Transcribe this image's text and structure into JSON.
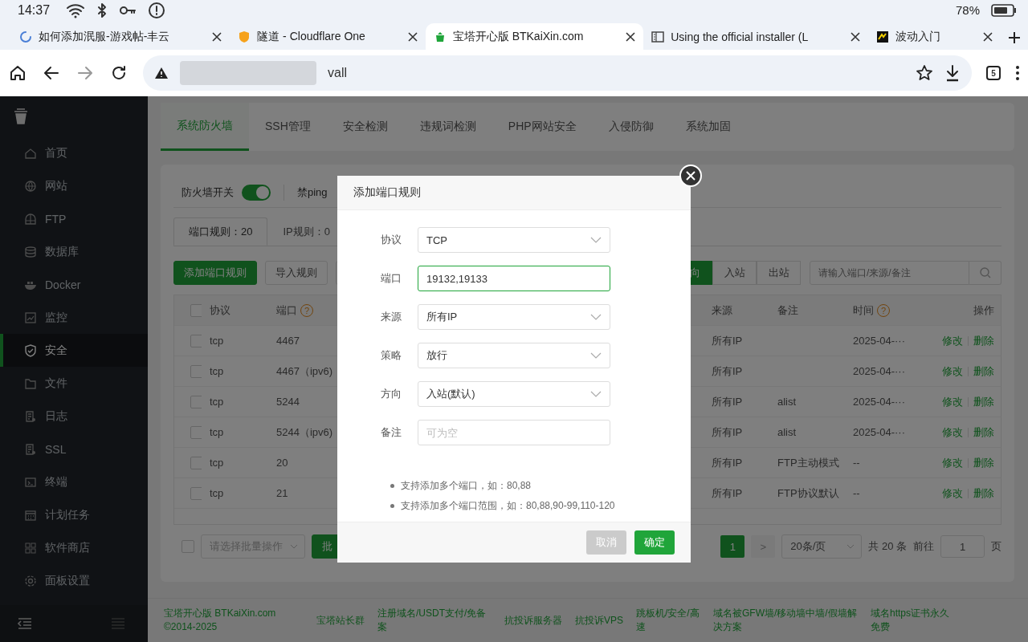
{
  "status_bar": {
    "time": "14:37",
    "battery": "78%"
  },
  "browser_tabs": [
    {
      "title": "如何添加泯服-游戏帖-丰云",
      "selected": false
    },
    {
      "title": "隧道 - Cloudflare One",
      "selected": false
    },
    {
      "title": "宝塔开心版 BTKaiXin.com",
      "selected": true
    },
    {
      "title": "Using the official installer (L",
      "selected": false
    },
    {
      "title": "波动入门",
      "selected": false
    }
  ],
  "address_bar": {
    "url": "vall",
    "tab_count": "5"
  },
  "sidebar": {
    "items": [
      {
        "label": "首页",
        "selected": false
      },
      {
        "label": "网站",
        "selected": false
      },
      {
        "label": "FTP",
        "selected": false
      },
      {
        "label": "数据库",
        "selected": false
      },
      {
        "label": "Docker",
        "selected": false
      },
      {
        "label": "监控",
        "selected": false
      },
      {
        "label": "安全",
        "selected": true
      },
      {
        "label": "文件",
        "selected": false
      },
      {
        "label": "日志",
        "selected": false
      },
      {
        "label": "SSL",
        "selected": false
      },
      {
        "label": "终端",
        "selected": false
      },
      {
        "label": "计划任务",
        "selected": false
      },
      {
        "label": "软件商店",
        "selected": false
      },
      {
        "label": "面板设置",
        "selected": false
      }
    ]
  },
  "top_tabs": [
    {
      "label": "系统防火墙",
      "selected": true
    },
    {
      "label": "SSH管理",
      "selected": false
    },
    {
      "label": "安全检测",
      "selected": false
    },
    {
      "label": "违规词检测",
      "selected": false
    },
    {
      "label": "PHP网站安全",
      "selected": false
    },
    {
      "label": "入侵防御",
      "selected": false
    },
    {
      "label": "系统加固",
      "selected": false
    }
  ],
  "firewall": {
    "switch": {
      "label": "防火墙开关",
      "on": true
    },
    "ping_label": "禁ping",
    "sub_tabs": [
      {
        "label": "端口规则：20",
        "selected": true
      },
      {
        "label": "IP规则：0",
        "selected": false
      }
    ],
    "buttons": [
      {
        "label": "添加端口规则",
        "kind": "primary"
      },
      {
        "label": "导入规则",
        "kind": "plain"
      }
    ],
    "direction_filter": [
      {
        "label": "向",
        "selected": true
      },
      {
        "label": "入站",
        "selected": false
      },
      {
        "label": "出站",
        "selected": false
      }
    ],
    "search": {
      "placeholder": "请输入端口/来源/备注"
    },
    "table": {
      "select_all_checked": false,
      "columns": [
        {
          "label": "协议"
        },
        {
          "label": "端口",
          "hint": "?"
        },
        {
          "label": "来源"
        },
        {
          "label": "备注"
        },
        {
          "label": "时间",
          "hint": "?"
        },
        {
          "label": "操作"
        }
      ],
      "rows": [
        {
          "checked": false,
          "protocol": "tcp",
          "port": "4467",
          "source": "所有IP",
          "time": "2025-04-···",
          "actions": [
            "修改",
            "删除"
          ]
        },
        {
          "checked": false,
          "protocol": "tcp",
          "port": "4467（ipv6)",
          "source": "所有IP",
          "time": "2025-04-···",
          "actions": [
            "修改",
            "删除"
          ]
        },
        {
          "checked": false,
          "protocol": "tcp",
          "port": "5244",
          "source": "所有IP",
          "note": "alist",
          "time": "2025-04-···",
          "actions": [
            "修改",
            "删除"
          ]
        },
        {
          "checked": false,
          "protocol": "tcp",
          "port": "5244（ipv6)",
          "source": "所有IP",
          "note": "alist",
          "time": "2025-04-···",
          "actions": [
            "修改",
            "删除"
          ]
        },
        {
          "checked": false,
          "protocol": "tcp",
          "port": "20",
          "source": "所有IP",
          "note": "FTP主动模式",
          "time": "--",
          "actions": [
            "修改",
            "删除"
          ]
        },
        {
          "checked": false,
          "protocol": "tcp",
          "port": "21",
          "source": "所有IP",
          "note": "FTP协议默认",
          "time": "--",
          "actions": [
            "修改",
            "删除"
          ]
        }
      ]
    },
    "batch": {
      "checked": false,
      "placeholder": "请选择批量操作",
      "button": "批"
    },
    "pagination": {
      "page": "1",
      "next": ">",
      "page_size": "20条/页",
      "total": "共 20 条",
      "goto_label": "前往",
      "goto_value": "1",
      "goto_suffix": "页"
    }
  },
  "dialog": {
    "title": "添加端口规则",
    "fields": [
      {
        "label": "协议",
        "kind": "select",
        "value": "TCP",
        "focused": false
      },
      {
        "label": "端口",
        "kind": "input",
        "value": "19132,19133",
        "focused": true
      },
      {
        "label": "来源",
        "kind": "select",
        "value": "所有IP",
        "focused": false
      },
      {
        "label": "策略",
        "kind": "select",
        "value": "放行",
        "focused": false
      },
      {
        "label": "方向",
        "kind": "select",
        "value": "入站(默认)",
        "focused": false
      },
      {
        "label": "备注",
        "kind": "input",
        "placeholder": "可为空",
        "focused": false
      }
    ],
    "notes": [
      "支持添加多个端口，如：80,88",
      "支持添加多个端口范围，如：80,88,90-99,110-120"
    ],
    "buttons": [
      {
        "label": "取消",
        "kind": "cancel"
      },
      {
        "label": "确定",
        "kind": "primary"
      }
    ]
  },
  "footer": {
    "links": [
      "宝塔开心版 BTKaiXin.com ©2014-2025",
      "宝塔站长群",
      "注册域名/USDT支付/免备案",
      "抗投诉服务器",
      "抗投诉VPS",
      "跳板机/安全/高速",
      "域名被GFW墙/移动墙中墙/假墙解决方案",
      "域名https证书永久免费"
    ]
  }
}
